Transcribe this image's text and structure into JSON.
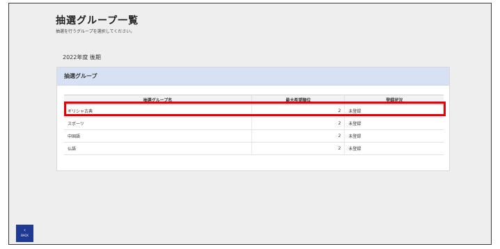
{
  "header": {
    "title": "抽選グループ一覧",
    "subtitle": "抽選を行うグループを選択してください。"
  },
  "term": "2022年度 後期",
  "card": {
    "title": "抽選グループ",
    "columns": [
      "抽選グループ名",
      "最大希望順位",
      "登録状況"
    ],
    "rows": [
      {
        "name": "ギリシャ古典",
        "rank": "2",
        "status": "未登録"
      },
      {
        "name": "スポーツ",
        "rank": "2",
        "status": "未登録"
      },
      {
        "name": "中国語",
        "rank": "2",
        "status": "未登録"
      },
      {
        "name": "仏語",
        "rank": "2",
        "status": "未登録"
      }
    ]
  },
  "back": {
    "icon": "chevron-left-icon",
    "label": "BACK"
  },
  "colors": {
    "highlight": "#e60000",
    "card_header": "#d6e2f4",
    "back_button": "#1f3a93"
  }
}
